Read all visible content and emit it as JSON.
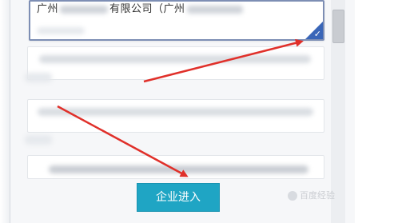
{
  "selected_company": {
    "name_prefix": "广州",
    "name_middle": "有限公司（广州",
    "selected": true,
    "check_symbol": "✓"
  },
  "enter_button": {
    "label": "企业进入"
  },
  "watermark": {
    "text": "百度经验"
  },
  "colors": {
    "accent_button": "#1fa5c4",
    "selected_border": "#7d8eb4",
    "check_corner": "#3a66b8",
    "arrow": "#e0302a"
  },
  "icons": {
    "check": "check-icon",
    "watermark": "watermark-logo-icon"
  }
}
